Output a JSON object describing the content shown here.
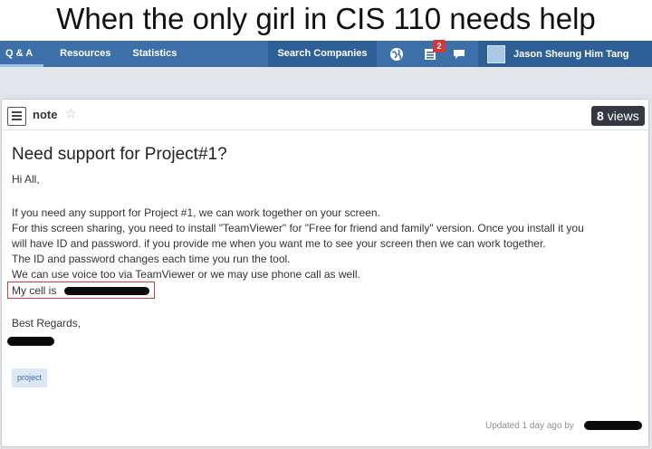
{
  "meme": {
    "caption": "When the only girl in CIS 110 needs help"
  },
  "navbar": {
    "tabs": [
      {
        "label": "Q & A"
      },
      {
        "label": "Resources"
      },
      {
        "label": "Statistics"
      }
    ],
    "search_label": "Search Companies",
    "icons": [
      "globe-icon",
      "inbox-icon",
      "chat-icon"
    ],
    "notification_count": "2",
    "user_name": "Jason Sheung Him Tang",
    "colors": {
      "bar": "#3d6fa8",
      "dark": "#2e5f96"
    }
  },
  "note": {
    "type_label": "note",
    "views_count": "8",
    "views_label": "views",
    "title": "Need support for Project#1?",
    "greeting": "Hi All,",
    "body_lines": [
      "If you need any support for Project #1, we can work together on your screen.",
      "For this screen sharing, you need to install \"TeamViewer\" for \"Free for friend and family\" version. Once you install it you",
      "will have ID and password. if you provide me when you want me to see your screen then we can work together.",
      "The ID and password changes each time you run the tool.",
      "We can use voice too via TeamViewer or we may use phone call as well."
    ],
    "cell_label": "My cell is",
    "closing": "Best Regards,",
    "tag": "project",
    "updated_text": "Updated 1 day ago by",
    "highlight_color": "#d23c3c"
  }
}
